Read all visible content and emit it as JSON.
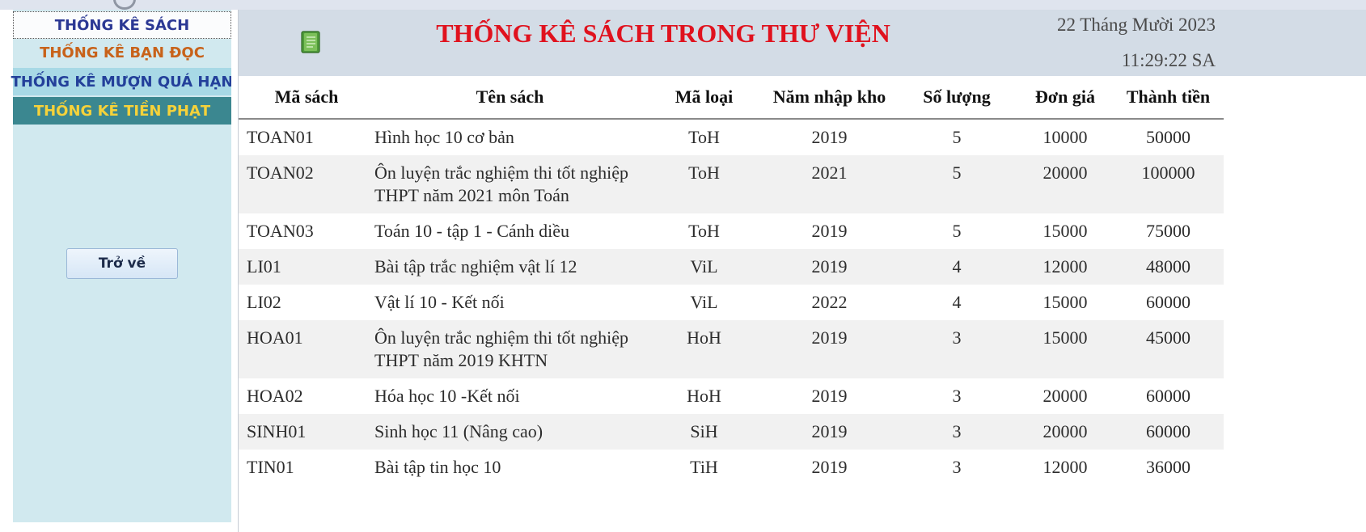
{
  "sidebar": {
    "items": [
      {
        "label": "THỐNG KÊ SÁCH"
      },
      {
        "label": "THỐNG KÊ BẠN ĐỌC"
      },
      {
        "label": "THỐNG KÊ MƯỢN QUÁ HẠN"
      },
      {
        "label": "THỐNG KÊ TIỀN PHẠT"
      }
    ],
    "back_button": "Trở về"
  },
  "header": {
    "title": "THỐNG KÊ SÁCH TRONG THƯ VIỆN",
    "date": "22 Tháng Mười 2023",
    "time": "11:29:22 SA",
    "icon": "notebook-icon"
  },
  "table": {
    "columns": [
      "Mã sách",
      "Tên sách",
      "Mã loại",
      "Năm nhập kho",
      "Số lượng",
      "Đơn giá",
      "Thành tiền"
    ],
    "rows": [
      [
        "TOAN01",
        "Hình học 10 cơ bản",
        "ToH",
        "2019",
        "5",
        "10000",
        "50000"
      ],
      [
        "TOAN02",
        "Ôn luyện trắc nghiệm thi tốt nghiệp THPT năm 2021 môn Toán",
        "ToH",
        "2021",
        "5",
        "20000",
        "100000"
      ],
      [
        "TOAN03",
        "Toán 10 - tập 1 - Cánh diều",
        "ToH",
        "2019",
        "5",
        "15000",
        "75000"
      ],
      [
        "LI01",
        "Bài tập trắc nghiệm vật lí 12",
        "ViL",
        "2019",
        "4",
        "12000",
        "48000"
      ],
      [
        "LI02",
        "Vật lí 10 - Kết nối",
        "ViL",
        "2022",
        "4",
        "15000",
        "60000"
      ],
      [
        "HOA01",
        "Ôn luyện trắc nghiệm thi tốt nghiệp THPT năm 2019 KHTN",
        "HoH",
        "2019",
        "3",
        "15000",
        "45000"
      ],
      [
        "HOA02",
        "Hóa học 10 -Kết nối",
        "HoH",
        "2019",
        "3",
        "20000",
        "60000"
      ],
      [
        "SINH01",
        "Sinh học 11 (Nâng cao)",
        "SiH",
        "2019",
        "3",
        "20000",
        "60000"
      ],
      [
        "TIN01",
        "Bài tập tin học 10",
        "TiH",
        "2019",
        "3",
        "12000",
        "36000"
      ]
    ]
  },
  "colors": {
    "title": "#e0121e",
    "sidebar_bg": "#d1e9ef",
    "header_bg": "#d3dce6"
  }
}
